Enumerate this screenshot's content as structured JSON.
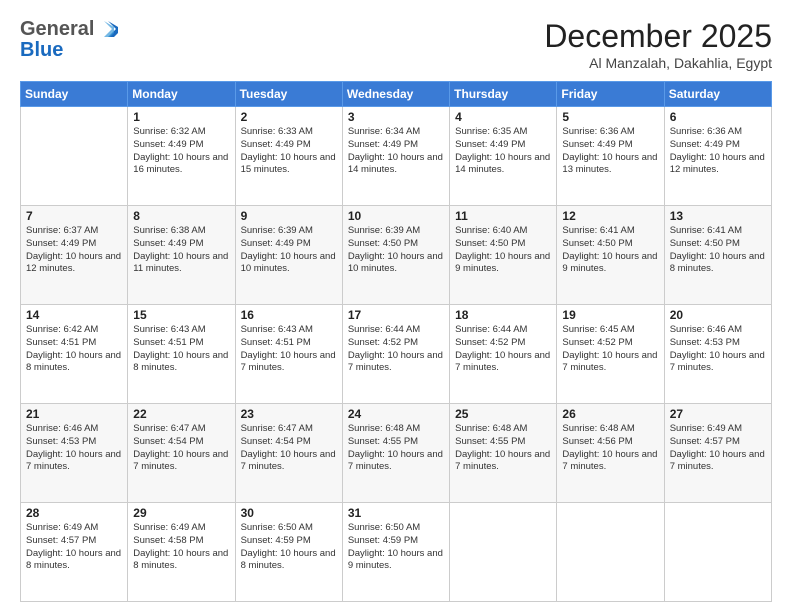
{
  "header": {
    "logo_general": "General",
    "logo_blue": "Blue",
    "month_title": "December 2025",
    "location": "Al Manzalah, Dakahlia, Egypt"
  },
  "weekdays": [
    "Sunday",
    "Monday",
    "Tuesday",
    "Wednesday",
    "Thursday",
    "Friday",
    "Saturday"
  ],
  "weeks": [
    [
      {
        "day": "",
        "info": ""
      },
      {
        "day": "1",
        "info": "Sunrise: 6:32 AM\nSunset: 4:49 PM\nDaylight: 10 hours\nand 16 minutes."
      },
      {
        "day": "2",
        "info": "Sunrise: 6:33 AM\nSunset: 4:49 PM\nDaylight: 10 hours\nand 15 minutes."
      },
      {
        "day": "3",
        "info": "Sunrise: 6:34 AM\nSunset: 4:49 PM\nDaylight: 10 hours\nand 14 minutes."
      },
      {
        "day": "4",
        "info": "Sunrise: 6:35 AM\nSunset: 4:49 PM\nDaylight: 10 hours\nand 14 minutes."
      },
      {
        "day": "5",
        "info": "Sunrise: 6:36 AM\nSunset: 4:49 PM\nDaylight: 10 hours\nand 13 minutes."
      },
      {
        "day": "6",
        "info": "Sunrise: 6:36 AM\nSunset: 4:49 PM\nDaylight: 10 hours\nand 12 minutes."
      }
    ],
    [
      {
        "day": "7",
        "info": "Sunrise: 6:37 AM\nSunset: 4:49 PM\nDaylight: 10 hours\nand 12 minutes."
      },
      {
        "day": "8",
        "info": "Sunrise: 6:38 AM\nSunset: 4:49 PM\nDaylight: 10 hours\nand 11 minutes."
      },
      {
        "day": "9",
        "info": "Sunrise: 6:39 AM\nSunset: 4:49 PM\nDaylight: 10 hours\nand 10 minutes."
      },
      {
        "day": "10",
        "info": "Sunrise: 6:39 AM\nSunset: 4:50 PM\nDaylight: 10 hours\nand 10 minutes."
      },
      {
        "day": "11",
        "info": "Sunrise: 6:40 AM\nSunset: 4:50 PM\nDaylight: 10 hours\nand 9 minutes."
      },
      {
        "day": "12",
        "info": "Sunrise: 6:41 AM\nSunset: 4:50 PM\nDaylight: 10 hours\nand 9 minutes."
      },
      {
        "day": "13",
        "info": "Sunrise: 6:41 AM\nSunset: 4:50 PM\nDaylight: 10 hours\nand 8 minutes."
      }
    ],
    [
      {
        "day": "14",
        "info": "Sunrise: 6:42 AM\nSunset: 4:51 PM\nDaylight: 10 hours\nand 8 minutes."
      },
      {
        "day": "15",
        "info": "Sunrise: 6:43 AM\nSunset: 4:51 PM\nDaylight: 10 hours\nand 8 minutes."
      },
      {
        "day": "16",
        "info": "Sunrise: 6:43 AM\nSunset: 4:51 PM\nDaylight: 10 hours\nand 7 minutes."
      },
      {
        "day": "17",
        "info": "Sunrise: 6:44 AM\nSunset: 4:52 PM\nDaylight: 10 hours\nand 7 minutes."
      },
      {
        "day": "18",
        "info": "Sunrise: 6:44 AM\nSunset: 4:52 PM\nDaylight: 10 hours\nand 7 minutes."
      },
      {
        "day": "19",
        "info": "Sunrise: 6:45 AM\nSunset: 4:52 PM\nDaylight: 10 hours\nand 7 minutes."
      },
      {
        "day": "20",
        "info": "Sunrise: 6:46 AM\nSunset: 4:53 PM\nDaylight: 10 hours\nand 7 minutes."
      }
    ],
    [
      {
        "day": "21",
        "info": "Sunrise: 6:46 AM\nSunset: 4:53 PM\nDaylight: 10 hours\nand 7 minutes."
      },
      {
        "day": "22",
        "info": "Sunrise: 6:47 AM\nSunset: 4:54 PM\nDaylight: 10 hours\nand 7 minutes."
      },
      {
        "day": "23",
        "info": "Sunrise: 6:47 AM\nSunset: 4:54 PM\nDaylight: 10 hours\nand 7 minutes."
      },
      {
        "day": "24",
        "info": "Sunrise: 6:48 AM\nSunset: 4:55 PM\nDaylight: 10 hours\nand 7 minutes."
      },
      {
        "day": "25",
        "info": "Sunrise: 6:48 AM\nSunset: 4:55 PM\nDaylight: 10 hours\nand 7 minutes."
      },
      {
        "day": "26",
        "info": "Sunrise: 6:48 AM\nSunset: 4:56 PM\nDaylight: 10 hours\nand 7 minutes."
      },
      {
        "day": "27",
        "info": "Sunrise: 6:49 AM\nSunset: 4:57 PM\nDaylight: 10 hours\nand 7 minutes."
      }
    ],
    [
      {
        "day": "28",
        "info": "Sunrise: 6:49 AM\nSunset: 4:57 PM\nDaylight: 10 hours\nand 8 minutes."
      },
      {
        "day": "29",
        "info": "Sunrise: 6:49 AM\nSunset: 4:58 PM\nDaylight: 10 hours\nand 8 minutes."
      },
      {
        "day": "30",
        "info": "Sunrise: 6:50 AM\nSunset: 4:59 PM\nDaylight: 10 hours\nand 8 minutes."
      },
      {
        "day": "31",
        "info": "Sunrise: 6:50 AM\nSunset: 4:59 PM\nDaylight: 10 hours\nand 9 minutes."
      },
      {
        "day": "",
        "info": ""
      },
      {
        "day": "",
        "info": ""
      },
      {
        "day": "",
        "info": ""
      }
    ]
  ]
}
